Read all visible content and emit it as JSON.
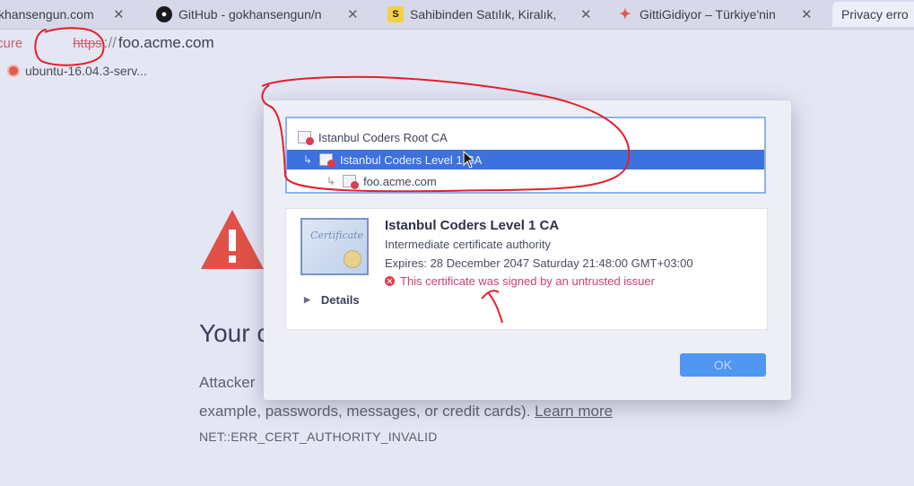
{
  "tabs": [
    {
      "title": "khansengun.com"
    },
    {
      "title": "GitHub - gokhansengun/n"
    },
    {
      "title": "Sahibinden Satılık, Kiralık,"
    },
    {
      "title": "GittiGidiyor – Türkiye'nin"
    },
    {
      "title": "Privacy erro"
    }
  ],
  "address_bar": {
    "security_label": "cure",
    "scheme": "https",
    "host": "foo.acme.com"
  },
  "bookmarks": [
    {
      "label": "ubuntu-16.04.3-serv..."
    }
  ],
  "certificate_chain": [
    {
      "name": "Istanbul Coders Root CA"
    },
    {
      "name": "Istanbul Coders Level 1 CA"
    },
    {
      "name": "foo.acme.com"
    }
  ],
  "certificate": {
    "icon_script": "Certificate",
    "name": "Istanbul Coders Level 1 CA",
    "type": "Intermediate certificate authority",
    "expires": "Expires: 28 December 2047 Saturday 21:48:00 GMT+03:00",
    "error": "This certificate was signed by an untrusted issuer",
    "details_label": "Details"
  },
  "dialog": {
    "ok_label": "OK"
  },
  "page": {
    "heading": "Your c",
    "body_line1": "Attacker",
    "body_line2": "example, passwords, messages, or credit cards).",
    "learn_more": "Learn more",
    "error_code": "NET::ERR_CERT_AUTHORITY_INVALID"
  },
  "colors": {
    "accent_blue": "#3d72de",
    "error_red": "#de3b52",
    "warning_triangle": "#e05147",
    "annotation_red": "#e3202a"
  }
}
